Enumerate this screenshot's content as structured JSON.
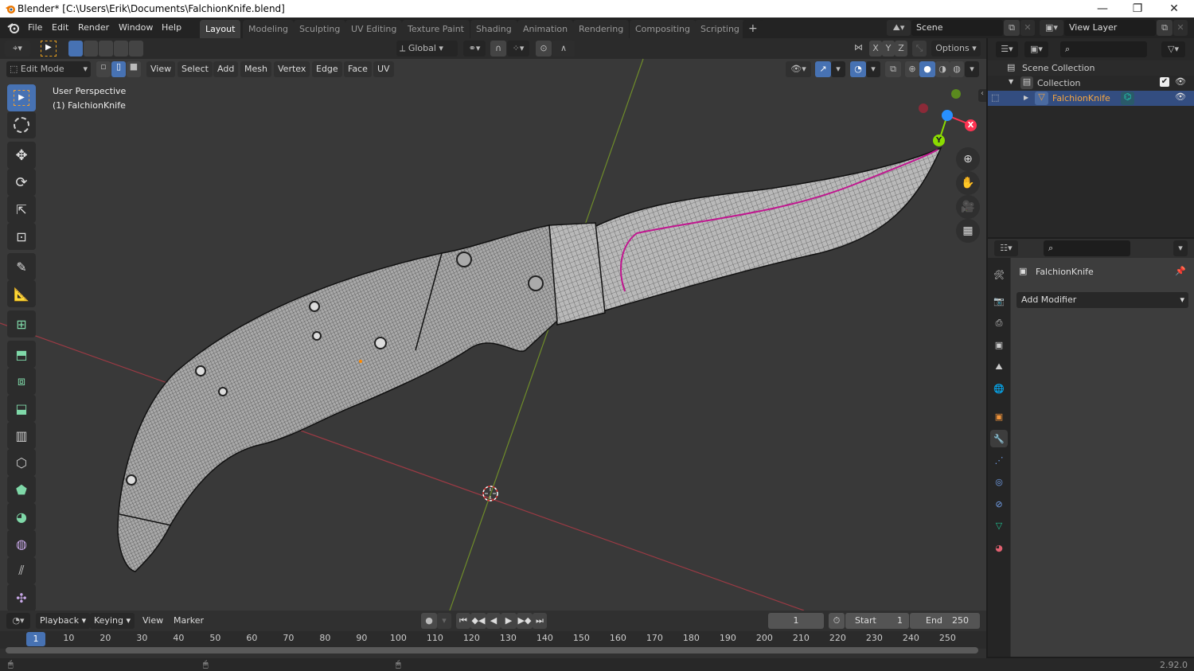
{
  "window": {
    "title": "Blender* [C:\\Users\\Erik\\Documents\\FalchionKnife.blend]",
    "controls": {
      "minimize": "—",
      "maximize": "❐",
      "close": "✕"
    }
  },
  "menubar": {
    "items": [
      "File",
      "Edit",
      "Render",
      "Window",
      "Help"
    ],
    "workspaces": [
      "Layout",
      "Modeling",
      "Sculpting",
      "UV Editing",
      "Texture Paint",
      "Shading",
      "Animation",
      "Rendering",
      "Compositing",
      "Scripting"
    ],
    "active_workspace": "Layout",
    "add_workspace": "+",
    "scene": "Scene",
    "view_layer": "View Layer"
  },
  "viewport_header": {
    "transform_orientation": "Global",
    "mirror_axes": [
      "X",
      "Y",
      "Z"
    ],
    "options_label": "Options",
    "mode": "Edit Mode",
    "menus": [
      "View",
      "Select",
      "Add",
      "Mesh",
      "Vertex",
      "Edge",
      "Face",
      "UV"
    ]
  },
  "viewport": {
    "view_name": "User Perspective",
    "object_label": "(1) FalchionKnife",
    "gizmo_axes": {
      "x": "X",
      "y": "Y",
      "z": ""
    },
    "colors": {
      "x_axis": "#ff3352",
      "y_axis": "#8bdc00",
      "z_axis": "#2890ff",
      "grid_x": "#9a3a44",
      "grid_y": "#6f8c2a",
      "seam": "#c0168f",
      "active_tool": "#4772b3"
    }
  },
  "toolbar": {
    "tools": [
      "select-box",
      "cursor",
      "move",
      "rotate",
      "scale",
      "transform",
      "annotate",
      "measure",
      "add-cube",
      "extrude-region",
      "inset-faces",
      "bevel",
      "loop-cut",
      "knife",
      "poly-build",
      "spin",
      "smooth",
      "edge-slide",
      "shrink-fatten"
    ]
  },
  "outliner": {
    "items": [
      {
        "label": "Scene Collection",
        "level": 0
      },
      {
        "label": "Collection",
        "level": 1
      },
      {
        "label": "FalchionKnife",
        "level": 2,
        "selected": true
      }
    ]
  },
  "properties": {
    "object_name": "FalchionKnife",
    "add_modifier_label": "Add Modifier",
    "tabs": [
      "tool",
      "render",
      "output",
      "view-layer",
      "scene",
      "world",
      "object",
      "modifiers",
      "particles",
      "physics",
      "constraints",
      "data",
      "material"
    ],
    "active_tab": "modifiers"
  },
  "timeline": {
    "menus": [
      "Playback",
      "Keying",
      "View",
      "Marker"
    ],
    "current_frame": "1",
    "start_label": "Start",
    "start": "1",
    "end_label": "End",
    "end": "250",
    "ticks": [
      "10",
      "20",
      "30",
      "40",
      "50",
      "60",
      "70",
      "80",
      "90",
      "100",
      "110",
      "120",
      "130",
      "140",
      "150",
      "160",
      "170",
      "180",
      "190",
      "200",
      "210",
      "220",
      "230",
      "240",
      "250"
    ],
    "playhead": "1"
  },
  "statusbar": {
    "version": "2.92.0"
  }
}
